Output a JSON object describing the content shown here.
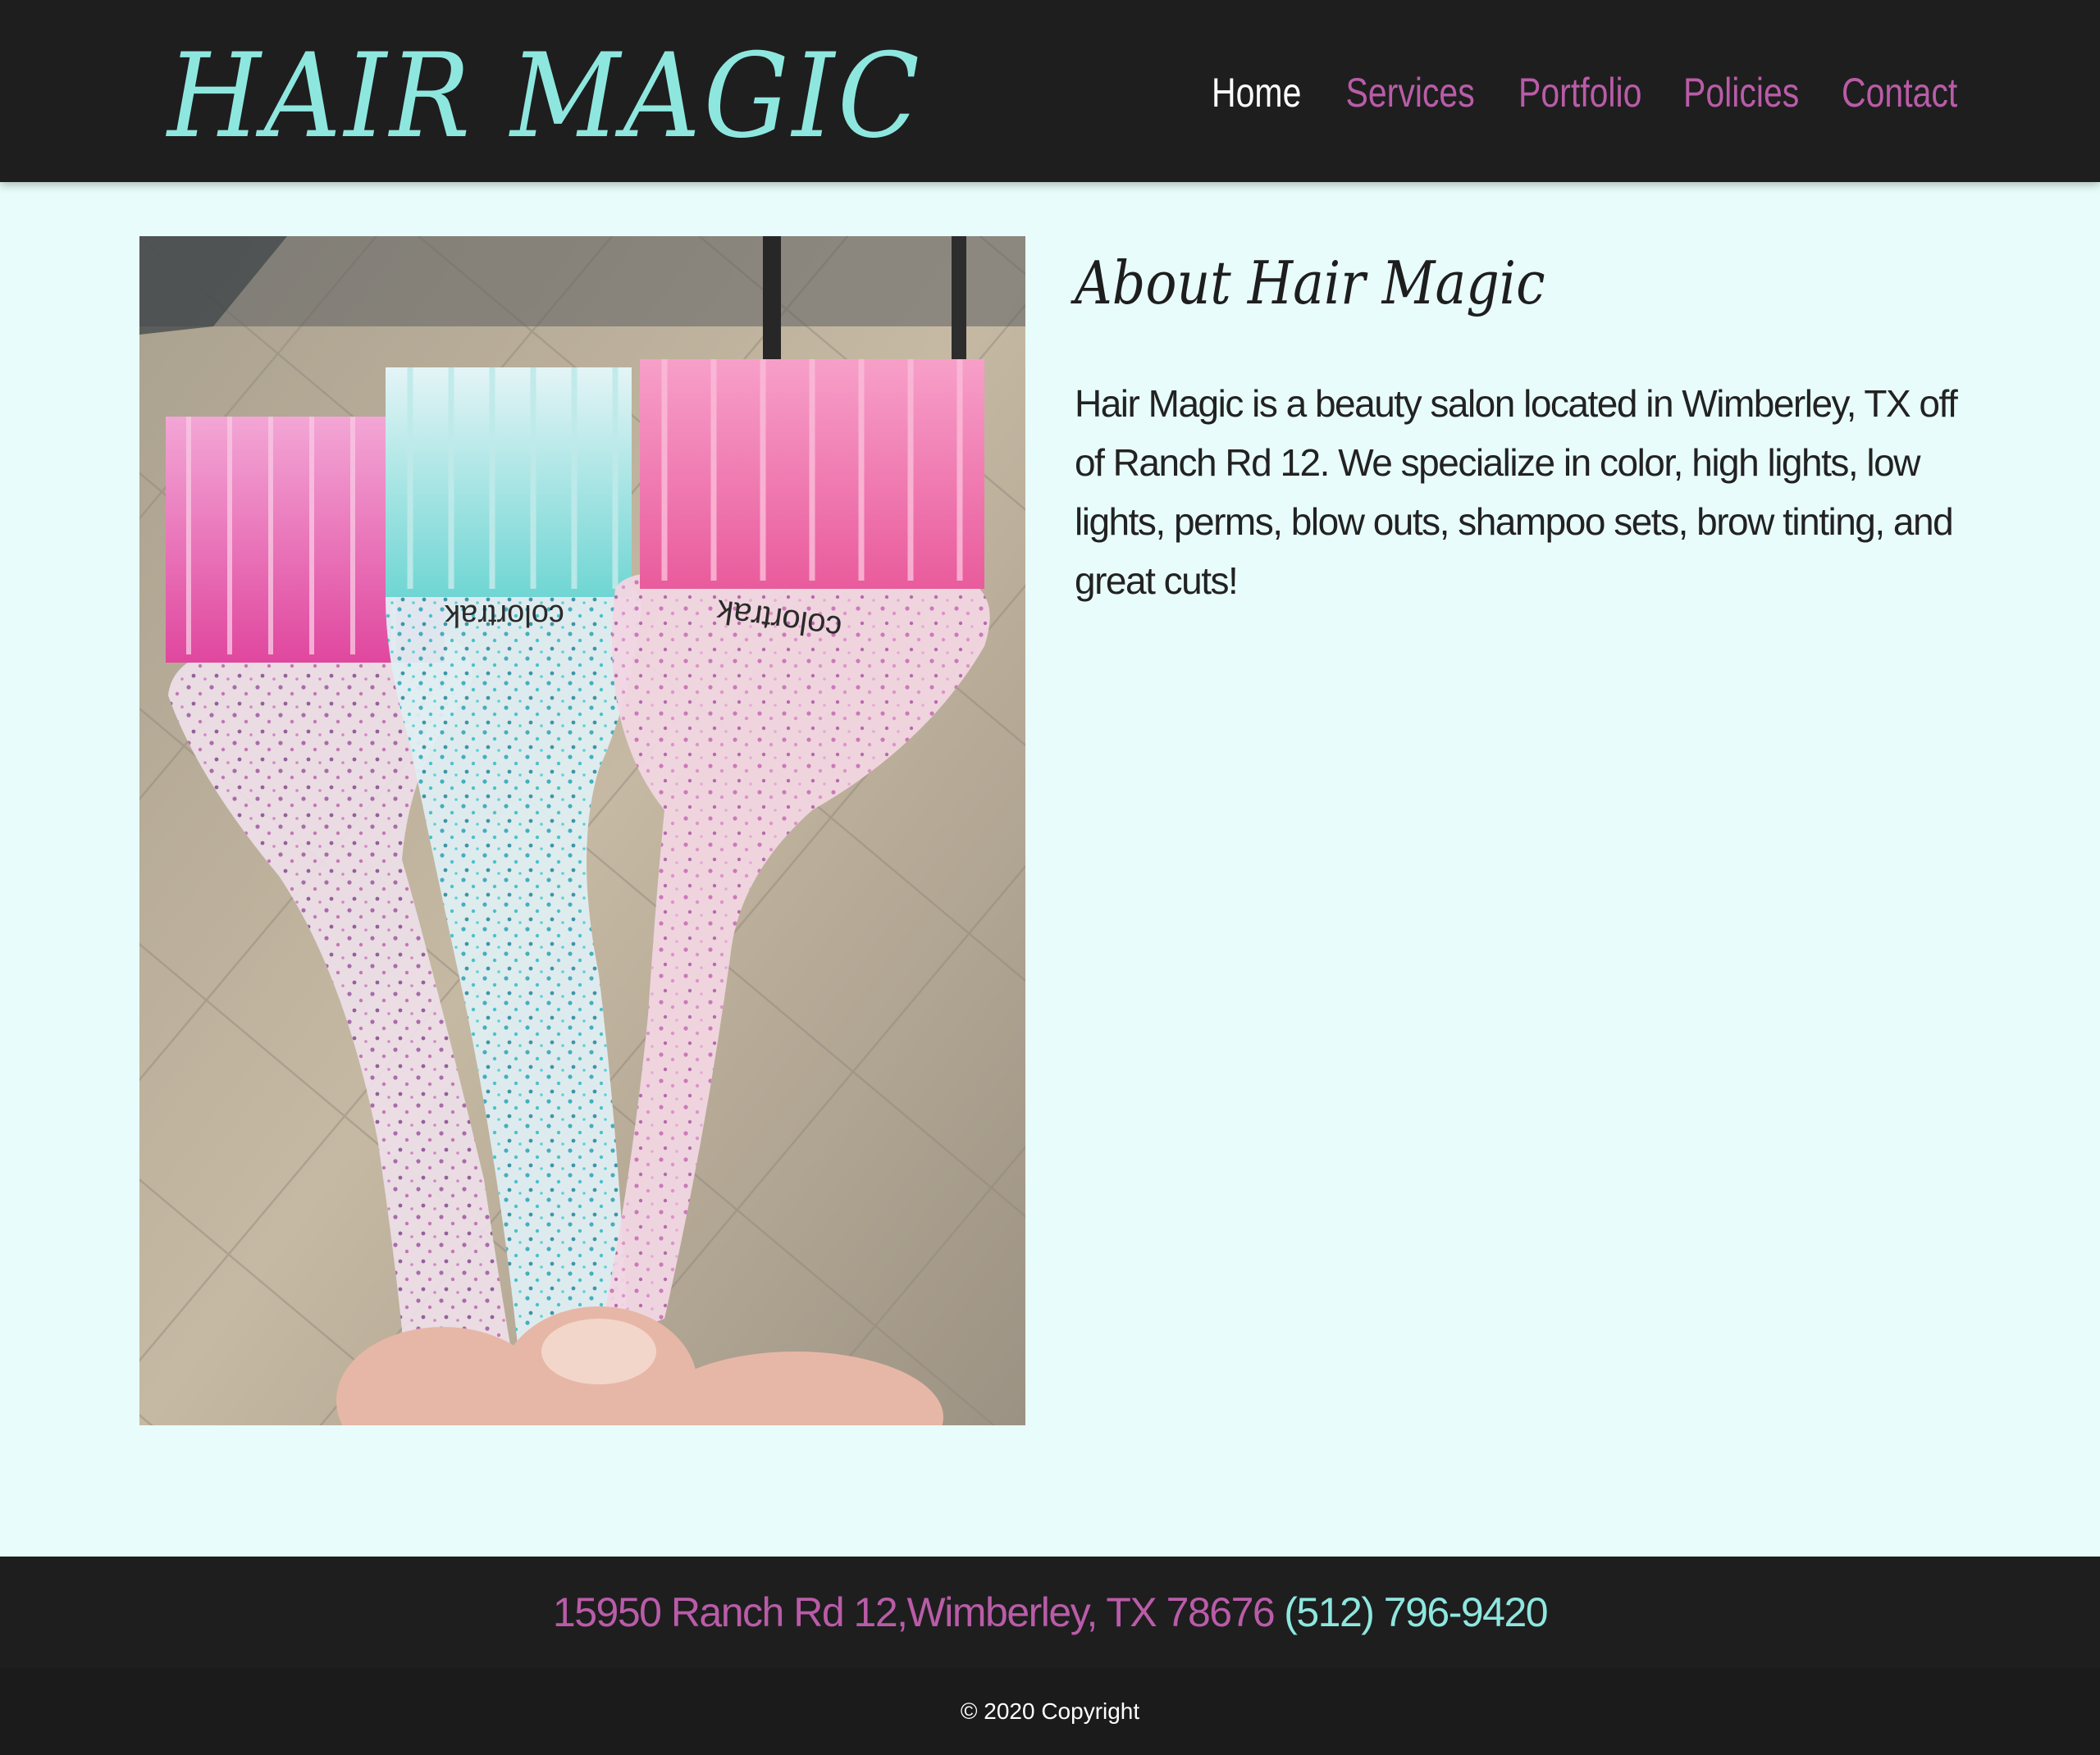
{
  "header": {
    "logo": "HAIR MAGIC",
    "nav": {
      "home": "Home",
      "services": "Services",
      "portfolio": "Portfolio",
      "policies": "Policies",
      "contact": "Contact"
    }
  },
  "main": {
    "photo_alt": "Three glitter hair color brushes",
    "brush_brand": "colortrak",
    "title": "About Hair Magic",
    "body": "Hair Magic is a beauty salon located in Wimberley, TX off of Ranch Rd 12. We specialize in color, high lights, low lights, perms, blow outs, shampoo sets, brow tinting, and great cuts!"
  },
  "footer": {
    "address": "15950 Ranch Rd 12,Wimberley, TX 78676",
    "phone": "(512) 796-9420",
    "copyright": "© 2020 Copyright"
  },
  "colors": {
    "header_bg": "#1e1e1e",
    "accent_teal": "#8ee7df",
    "accent_pink": "#b95ca8",
    "page_bg": "#e8fdfb"
  }
}
